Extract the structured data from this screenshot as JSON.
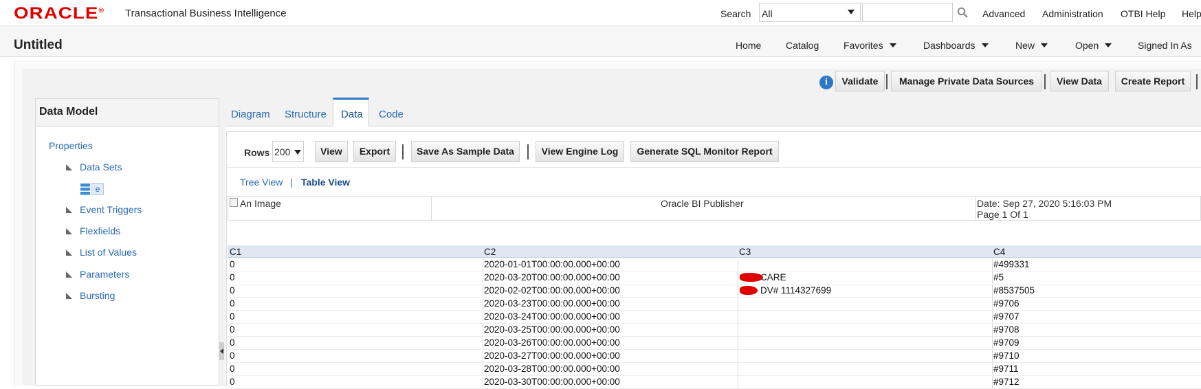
{
  "header": {
    "brand": "ORACLE",
    "product": "Transactional Business Intelligence",
    "search_label": "Search",
    "search_scope": "All",
    "search_value": "",
    "links": [
      "Advanced",
      "Administration",
      "OTBI Help",
      "Help"
    ]
  },
  "subheader": {
    "page_title": "Untitled",
    "nav": [
      {
        "label": "Home",
        "dropdown": false
      },
      {
        "label": "Catalog",
        "dropdown": false
      },
      {
        "label": "Favorites",
        "dropdown": true
      },
      {
        "label": "Dashboards",
        "dropdown": true
      },
      {
        "label": "New",
        "dropdown": true
      },
      {
        "label": "Open",
        "dropdown": true
      },
      {
        "label": "Signed In As",
        "dropdown": false
      }
    ]
  },
  "toolbar": {
    "info_glyph": "i",
    "validate": "Validate",
    "manage_sources": "Manage Private Data Sources",
    "view_data": "View Data",
    "create_report": "Create Report"
  },
  "data_model": {
    "title": "Data Model",
    "properties": "Properties",
    "items": [
      "Data Sets",
      "Event Triggers",
      "Flexfields",
      "List of Values",
      "Parameters",
      "Bursting"
    ],
    "dataset_name": "e"
  },
  "tabs": {
    "items": [
      "Diagram",
      "Structure",
      "Data",
      "Code"
    ],
    "active": "Data"
  },
  "data_tab": {
    "rows_label": "Rows",
    "rows_value": "200",
    "view": "View",
    "export": "Export",
    "save_sample": "Save As Sample Data",
    "engine_log": "View Engine Log",
    "sql_monitor": "Generate SQL Monitor Report",
    "tree_view": "Tree View",
    "separator": "|",
    "table_view": "Table View"
  },
  "report_header": {
    "image_alt": "An Image",
    "publisher": "Oracle BI Publisher",
    "date": "Date: Sep 27, 2020 5:16:03 PM",
    "page": "Page 1 Of 1"
  },
  "grid": {
    "columns": [
      "C1",
      "C2",
      "C3",
      "C4"
    ],
    "rows": [
      [
        "0",
        "2020-01-01T00:00:00.000+00:00",
        "",
        "#499331"
      ],
      [
        "0",
        "2020-03-20T00:00:00.000+00:00",
        "CARE",
        "#5"
      ],
      [
        "0",
        "2020-02-02T00:00:00.000+00:00",
        "DV# 1114327699",
        "#8537505"
      ],
      [
        "0",
        "2020-03-23T00:00:00.000+00:00",
        "",
        "#9706"
      ],
      [
        "0",
        "2020-03-24T00:00:00.000+00:00",
        "",
        "#9707"
      ],
      [
        "0",
        "2020-03-25T00:00:00.000+00:00",
        "",
        "#9708"
      ],
      [
        "0",
        "2020-03-26T00:00:00.000+00:00",
        "",
        "#9709"
      ],
      [
        "0",
        "2020-03-27T00:00:00.000+00:00",
        "",
        "#9710"
      ],
      [
        "0",
        "2020-03-28T00:00:00.000+00:00",
        "",
        "#9711"
      ],
      [
        "0",
        "2020-03-30T00:00:00.000+00:00",
        "",
        "#9712"
      ]
    ]
  },
  "colors": {
    "brand_red": "#e00000",
    "link_blue": "#2a6ab1",
    "active_tab_blue": "#2c78c6",
    "grid_header": "#dfe7f1"
  },
  "icons": [
    "search-icon",
    "info-icon",
    "dataset-icon",
    "collapse-triangle-icon",
    "chevron-down-icon",
    "broken-image-icon",
    "splitter-collapse-icon"
  ]
}
